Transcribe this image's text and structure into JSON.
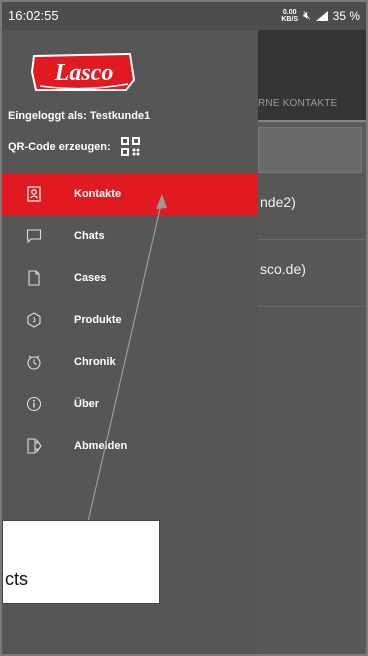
{
  "status": {
    "time": "16:02:55",
    "net_speed_top": "0.00",
    "net_speed_unit": "KB/S",
    "battery": "35 %"
  },
  "background_app": {
    "tab_label": "RNE KONTAKTE",
    "rows": [
      "nde2)",
      "sco.de)"
    ]
  },
  "drawer": {
    "logo_text": "Lasco",
    "logged_in_text": "Eingeloggt als: Testkunde1",
    "qr_label": "QR-Code erzeugen:",
    "menu": [
      {
        "label": "Kontakte",
        "icon": "contacts-icon",
        "active": true
      },
      {
        "label": "Chats",
        "icon": "chat-icon",
        "active": false
      },
      {
        "label": "Cases",
        "icon": "cases-icon",
        "active": false
      },
      {
        "label": "Produkte",
        "icon": "product-icon",
        "active": false
      },
      {
        "label": "Chronik",
        "icon": "clock-icon",
        "active": false
      },
      {
        "label": "Über",
        "icon": "info-icon",
        "active": false
      },
      {
        "label": "Abmelden",
        "icon": "logout-icon",
        "active": false
      }
    ]
  },
  "callout": {
    "text": "cts"
  },
  "colors": {
    "accent": "#e11a22",
    "drawer_bg": "#565656"
  }
}
